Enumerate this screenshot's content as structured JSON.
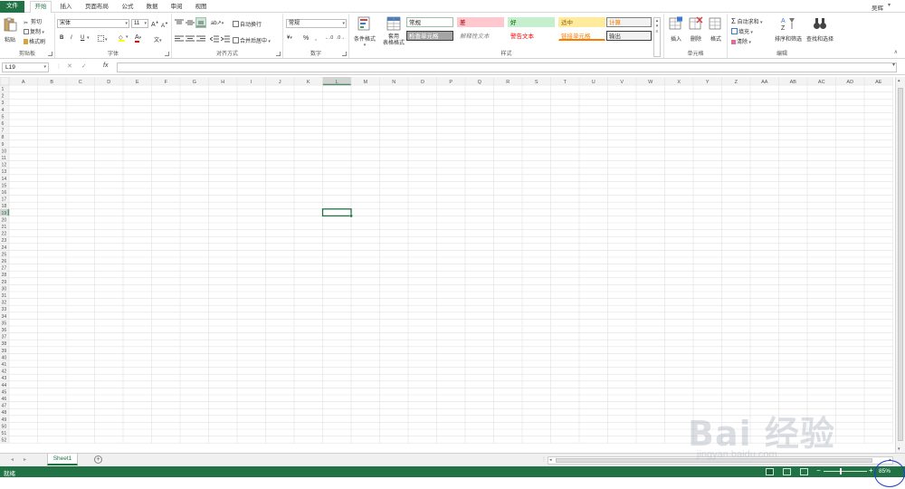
{
  "tabs": {
    "file": "文件",
    "items": [
      "开始",
      "插入",
      "页面布局",
      "公式",
      "数据",
      "审阅",
      "视图"
    ],
    "active_index": 0
  },
  "user": "吴辉",
  "ribbon": {
    "clipboard": {
      "paste": "粘贴",
      "cut": "剪切",
      "copy": "复制",
      "format_painter": "格式刷",
      "label": "剪贴板"
    },
    "font": {
      "name": "宋体",
      "size": "11",
      "bold": "B",
      "italic": "I",
      "underline": "U",
      "label": "字体"
    },
    "alignment": {
      "wrap": "自动换行",
      "merge": "合并后居中",
      "label": "对齐方式"
    },
    "number": {
      "format": "常规",
      "percent": "%",
      "comma": ",",
      "label": "数字"
    },
    "styles": {
      "conditional": "条件格式",
      "table": "套用\n表格格式",
      "label": "样式",
      "cells": [
        {
          "text": "常规",
          "bg": "#ffffff",
          "fg": "#222222",
          "border": "#9bc2a6"
        },
        {
          "text": "差",
          "bg": "#ffc7ce",
          "fg": "#9c0006",
          "border": "#ffc7ce"
        },
        {
          "text": "好",
          "bg": "#c6efce",
          "fg": "#006100",
          "border": "#c6efce"
        },
        {
          "text": "适中",
          "bg": "#ffeb9c",
          "fg": "#9c5700",
          "border": "#ffeb9c"
        },
        {
          "text": "计算",
          "bg": "#f2f2f2",
          "fg": "#fa7d00",
          "border": "#7f7f7f"
        },
        {
          "text": "检查单元格",
          "bg": "#a5a5a5",
          "fg": "#ffffff",
          "border": "#3f3f3f"
        },
        {
          "text": "解释性文本",
          "bg": "#ffffff",
          "fg": "#7f7f7f",
          "border": "#ffffff"
        },
        {
          "text": "警告文本",
          "bg": "#ffffff",
          "fg": "#ff0000",
          "border": "#ffffff"
        },
        {
          "text": "链接单元格",
          "bg": "#ffffff",
          "fg": "#fa7d00",
          "border": "#ffffff"
        },
        {
          "text": "输出",
          "bg": "#f2f2f2",
          "fg": "#3f3f3f",
          "border": "#3f3f3f"
        }
      ]
    },
    "cells": {
      "insert": "插入",
      "delete": "删除",
      "format": "格式",
      "label": "单元格"
    },
    "editing": {
      "autosum": "自动求和",
      "fill": "填充",
      "clear": "清除",
      "sort": "排序和筛选",
      "find": "查找和选择",
      "label": "编辑"
    }
  },
  "formula_bar": {
    "name_box": "L19",
    "fx": "fx",
    "formula": ""
  },
  "grid": {
    "columns": [
      "A",
      "B",
      "C",
      "D",
      "E",
      "F",
      "G",
      "H",
      "I",
      "J",
      "K",
      "L",
      "M",
      "N",
      "O",
      "P",
      "Q",
      "R",
      "S",
      "T",
      "U",
      "V",
      "W",
      "X",
      "Y",
      "Z",
      "AA",
      "AB",
      "AC",
      "AD",
      "AE"
    ],
    "row_count": 52,
    "active_col": "L",
    "active_row": 19
  },
  "sheets": {
    "tabs": [
      "Sheet1"
    ],
    "add": "+"
  },
  "status": {
    "ready": "就绪",
    "zoom": "85%",
    "zoom_level": 0.4
  },
  "watermark": {
    "main": "Bai 经验",
    "sub": "jingyan.baidu.com"
  },
  "colors": {
    "accent": "#217346",
    "grid_line": "#e1e1e1",
    "header_bg": "#f3f3f3",
    "annotation": "#1d3fd6"
  }
}
